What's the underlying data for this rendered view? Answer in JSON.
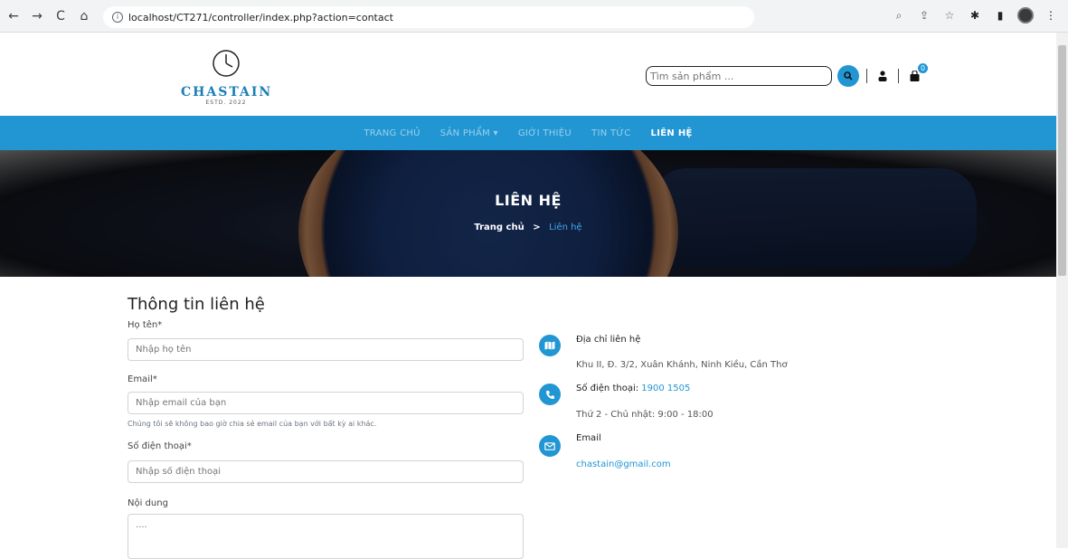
{
  "browser": {
    "url": "localhost/CT271/controller/index.php?action=contact"
  },
  "header": {
    "brand": "CHASTAIN",
    "estd": "ESTD. 2022",
    "search_placeholder": "Tìm sản phẩm ...",
    "cart_count": "0"
  },
  "nav": {
    "items": [
      {
        "label": "TRANG CHỦ"
      },
      {
        "label": "SẢN PHẨM ▾"
      },
      {
        "label": "GIỚI THIỆU"
      },
      {
        "label": "TIN TỨC"
      },
      {
        "label": "LIÊN HỆ"
      }
    ]
  },
  "hero": {
    "title": "LIÊN HỆ",
    "crumb_home": "Trang chủ",
    "crumb_sep": ">",
    "crumb_current": "Liên hệ"
  },
  "form": {
    "title": "Thông tin liên hệ",
    "name_label": "Họ tên*",
    "name_placeholder": "Nhập họ tên",
    "email_label": "Email*",
    "email_placeholder": "Nhập email của bạn",
    "email_help": "Chúng tôi sẽ không bao giờ chia sẻ email của bạn với bất kỳ ai khác.",
    "phone_label": "Số điện thoại*",
    "phone_placeholder": "Nhập số điện thoại",
    "content_label": "Nội dung",
    "content_placeholder": "...."
  },
  "info": {
    "address_title": "Địa chỉ liên hệ",
    "address": "Khu II, Đ. 3/2, Xuân Khánh, Ninh Kiều, Cần Thơ",
    "phone_title": "Số điện thoại:",
    "phone_number": "1900 1505",
    "hours": "Thứ 2 - Chủ nhật: 9:00 - 18:00",
    "email_title": "Email",
    "email": "chastain@gmail.com"
  },
  "colors": {
    "accent": "#2196d3",
    "brand": "#1a7fb7"
  }
}
